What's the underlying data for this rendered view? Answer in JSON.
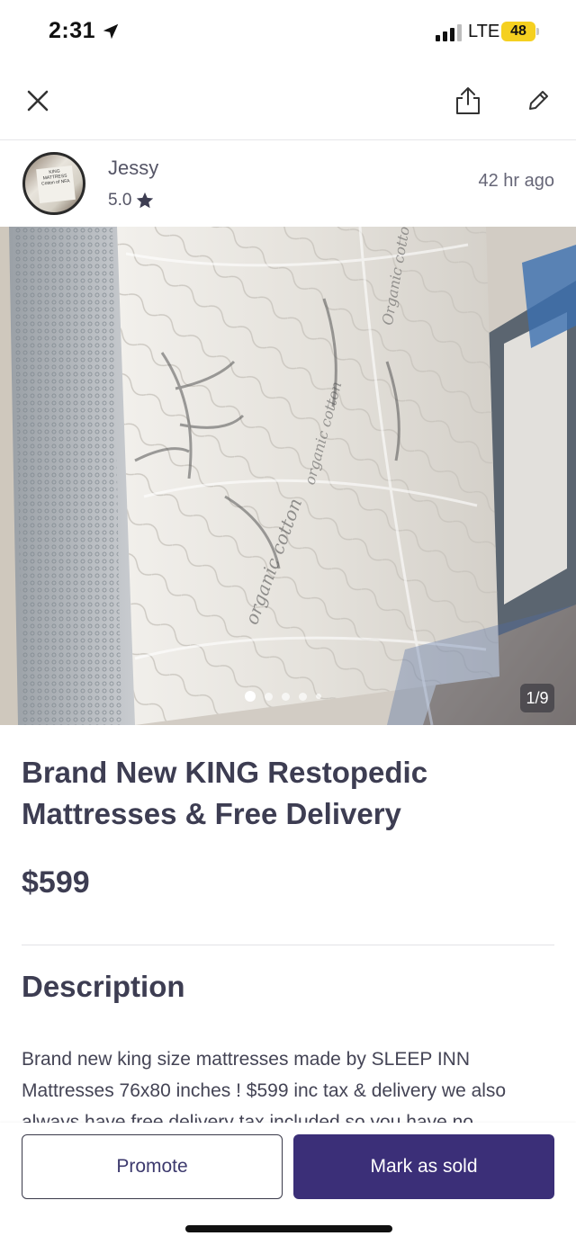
{
  "status_bar": {
    "time": "2:31",
    "network": "LTE",
    "battery": "48"
  },
  "toolbar": {
    "close_icon": "close-icon",
    "share_icon": "share-icon",
    "edit_icon": "edit-pencil-icon"
  },
  "seller": {
    "name": "Jessy",
    "rating": "5.0",
    "posted": "42 hr  ago",
    "avatar_tag": "KING MATTRESS Cotton of NFA"
  },
  "gallery": {
    "counter": "1/9",
    "current_index": 1,
    "total": 9,
    "print_text": [
      "organic cotton",
      "organic cotton",
      "Organic cotton"
    ]
  },
  "listing": {
    "title": "Brand New KING Restopedic Mattresses & Free Delivery",
    "price": "$599"
  },
  "description": {
    "heading": "Description",
    "text": "Brand new king size mattresses made by SLEEP INN Mattresses 76x80 inches ! $599 inc tax & delivery we also always have free delivery tax included so you have no"
  },
  "actions": {
    "promote_label": "Promote",
    "mark_sold_label": "Mark as sold"
  },
  "colors": {
    "accent": "#3b2f78",
    "heading_text": "#3d3d52",
    "battery": "#f5d020"
  }
}
